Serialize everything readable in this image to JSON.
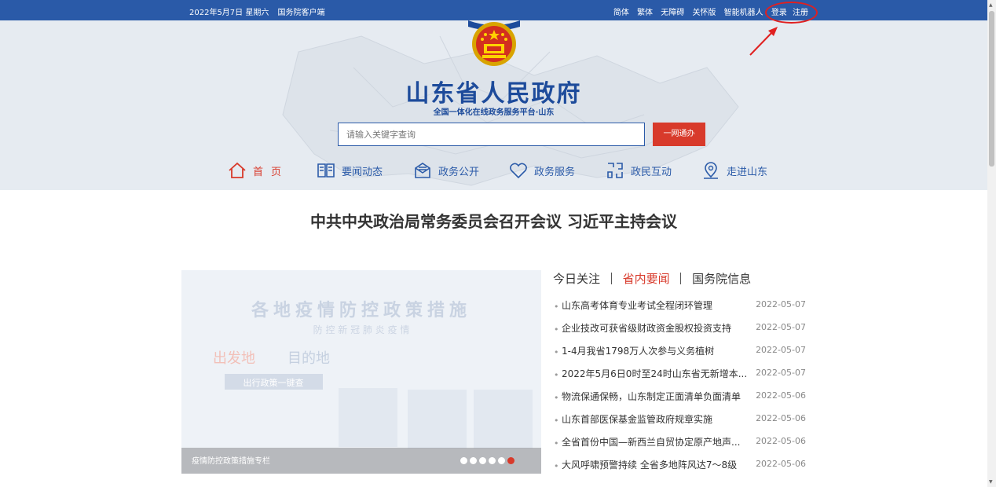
{
  "topbar": {
    "date": "2022年5月7日 星期六",
    "client_link": "国务院客户端",
    "links": [
      "简体",
      "繁体",
      "无障碍",
      "关怀版",
      "智能机器人",
      "登录",
      "注册"
    ]
  },
  "header": {
    "title": "山东省人民政府",
    "subtitle": "全国一体化在线政务服务平台·山东"
  },
  "search": {
    "placeholder": "请输入关键字查询",
    "button": "一网通办"
  },
  "nav": [
    {
      "label": "首页",
      "icon": "home-icon"
    },
    {
      "label": "要闻动态",
      "icon": "book-icon"
    },
    {
      "label": "政务公开",
      "icon": "mail-icon"
    },
    {
      "label": "政务服务",
      "icon": "heart-icon"
    },
    {
      "label": "政民互动",
      "icon": "interaction-icon"
    },
    {
      "label": "走进山东",
      "icon": "location-icon"
    }
  ],
  "headline": "中共中央政治局常务委员会召开会议 习近平主持会议",
  "slider": {
    "caption": "疫情防控政策措施专栏",
    "poster_title": "各地疫情防控政策措施",
    "poster_sub": "防 控 新 冠 肺 炎 疫 情",
    "poster_from": "出发地",
    "poster_to": "目的地",
    "poster_button": "出行政策一键查",
    "dot_count": 6,
    "active_dot": 5
  },
  "news": {
    "tabs": [
      "今日关注",
      "省内要闻",
      "国务院信息"
    ],
    "active_tab": 1,
    "items": [
      {
        "title": "山东高考体育专业考试全程闭环管理",
        "date": "2022-05-07"
      },
      {
        "title": "企业技改可获省级财政资金股权投资支持",
        "date": "2022-05-07"
      },
      {
        "title": "1-4月我省1798万人次参与义务植树",
        "date": "2022-05-07"
      },
      {
        "title": "2022年5月6日0时至24时山东省无新增本...",
        "date": "2022-05-07"
      },
      {
        "title": "物流保通保畅，山东制定正面清单负面清单",
        "date": "2022-05-06"
      },
      {
        "title": "山东首部医保基金监管政府规章实施",
        "date": "2022-05-06"
      },
      {
        "title": "全省首份中国—新西兰自贸协定原产地声...",
        "date": "2022-05-06"
      },
      {
        "title": "大风呼啸预警持续 全省多地阵风达7～8级",
        "date": "2022-05-06"
      }
    ]
  },
  "colors": {
    "primary_blue": "#2a5aa8",
    "accent_red": "#d83a2b",
    "title_blue": "#1d4b9b"
  }
}
